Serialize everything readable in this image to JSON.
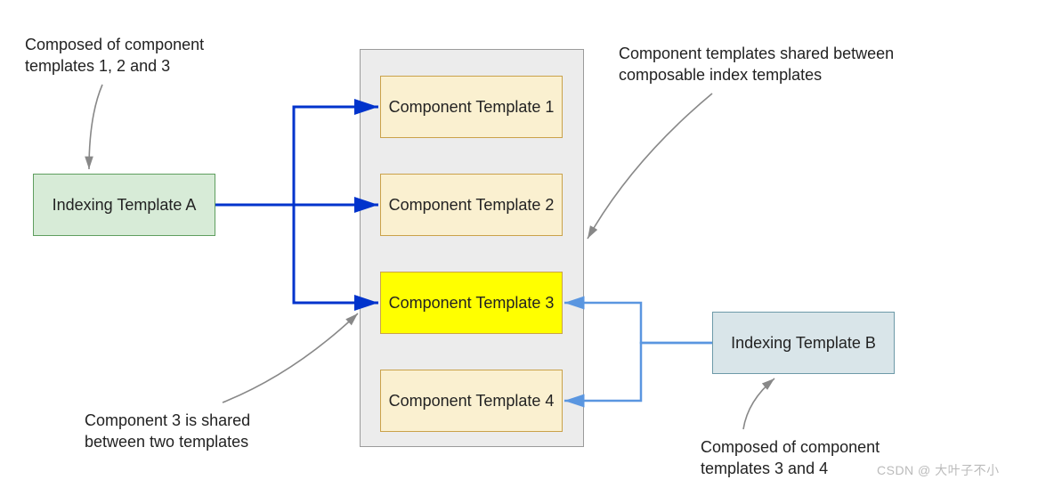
{
  "nodes": {
    "template_a": "Indexing\nTemplate A",
    "template_b": "Indexing\nTemplate B",
    "comp1": "Component\nTemplate 1",
    "comp2": "Component\nTemplate 2",
    "comp3": "Component\nTemplate 3",
    "comp4": "Component\nTemplate 4"
  },
  "annotations": {
    "composed_a": "Composed of component\ntemplates 1, 2 and 3",
    "shared_between": "Component templates shared between\ncomposable index templates",
    "comp3_shared": "Component 3 is shared\nbetween two templates",
    "composed_b": "Composed of component\ntemplates 3 and 4"
  },
  "colors": {
    "arrow_a": "#0033cc",
    "arrow_b": "#5a96e0",
    "pointer": "#888888",
    "template_a_fill": "#d7ebd7",
    "template_b_fill": "#d9e5e9",
    "component_fill": "#faf0d0",
    "component_highlight_fill": "#ffff00",
    "container_fill": "#ececec"
  },
  "watermark": "CSDN @ 大叶子不小"
}
